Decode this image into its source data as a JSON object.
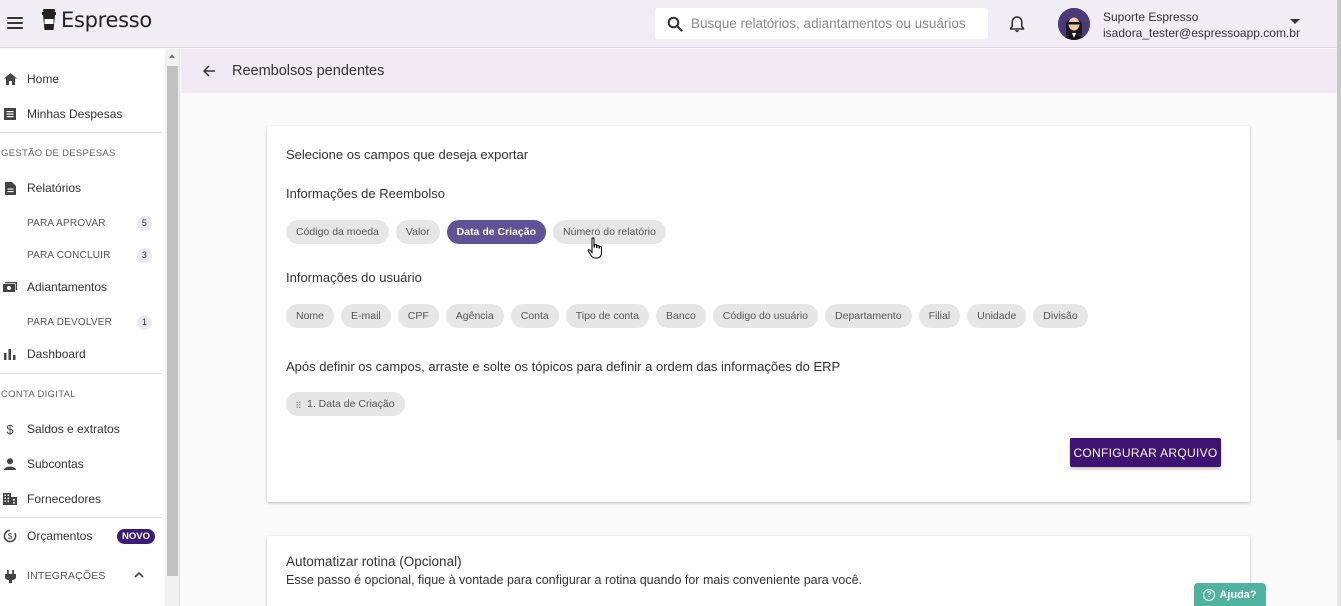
{
  "header": {
    "logo_text": "Espresso",
    "search_placeholder": "Busque relatórios, adiantamentos ou usuários",
    "user_name": "Suporte Espresso",
    "user_email": "isadora_tester@espressoapp.com.br"
  },
  "sidebar": {
    "home": "Home",
    "minhas_despesas": "Minhas Despesas",
    "section_gestao": "GESTÃO DE DESPESAS",
    "relatorios": "Relatórios",
    "para_aprovar": {
      "label": "PARA APROVAR",
      "count": "5"
    },
    "para_concluir": {
      "label": "PARA CONCLUIR",
      "count": "3"
    },
    "adiantamentos": "Adiantamentos",
    "para_devolver": {
      "label": "PARA DEVOLVER",
      "count": "1"
    },
    "dashboard": "Dashboard",
    "section_conta": "CONTA DIGITAL",
    "saldos": "Saldos e extratos",
    "subcontas": "Subcontas",
    "fornecedores": "Fornecedores",
    "orcamentos": "Orçamentos",
    "novo_badge": "NOVO",
    "integracoes": "INTEGRAÇÕES"
  },
  "page": {
    "title": "Reembolsos pendentes"
  },
  "export_card": {
    "heading": "Selecione os campos que deseja exportar",
    "reembolso_heading": "Informações de Reembolso",
    "reembolso_fields": [
      {
        "label": "Código da moeda"
      },
      {
        "label": "Valor"
      },
      {
        "label": "Data de Criação"
      },
      {
        "label": "Número do relatório"
      }
    ],
    "usuario_heading": "Informações do usuário",
    "usuario_fields": [
      {
        "label": "Nome"
      },
      {
        "label": "E-mail"
      },
      {
        "label": "CPF"
      },
      {
        "label": "Agência"
      },
      {
        "label": "Conta"
      },
      {
        "label": "Tipo de conta"
      },
      {
        "label": "Banco"
      },
      {
        "label": "Código do usuário"
      },
      {
        "label": "Departamento"
      },
      {
        "label": "Filial"
      },
      {
        "label": "Unidade"
      },
      {
        "label": "Divisão"
      }
    ],
    "order_instructions": "Após definir os campos, arraste e solte os tópicos para definir a ordem das informações do ERP",
    "order_items": [
      "1. Data de Criação"
    ],
    "configure_button": "CONFIGURAR ARQUIVO"
  },
  "routine_card": {
    "title": "Automatizar rotina (Opcional)",
    "description": "Esse passo é opcional, fique à vontade para configurar a rotina quando for mais conveniente para você."
  },
  "help_button": "Ajuda?",
  "colors": {
    "primary": "#3d1273",
    "chip_selected": "#5f5296",
    "header_bg": "#f1edf5",
    "help": "#4fb3a0"
  }
}
